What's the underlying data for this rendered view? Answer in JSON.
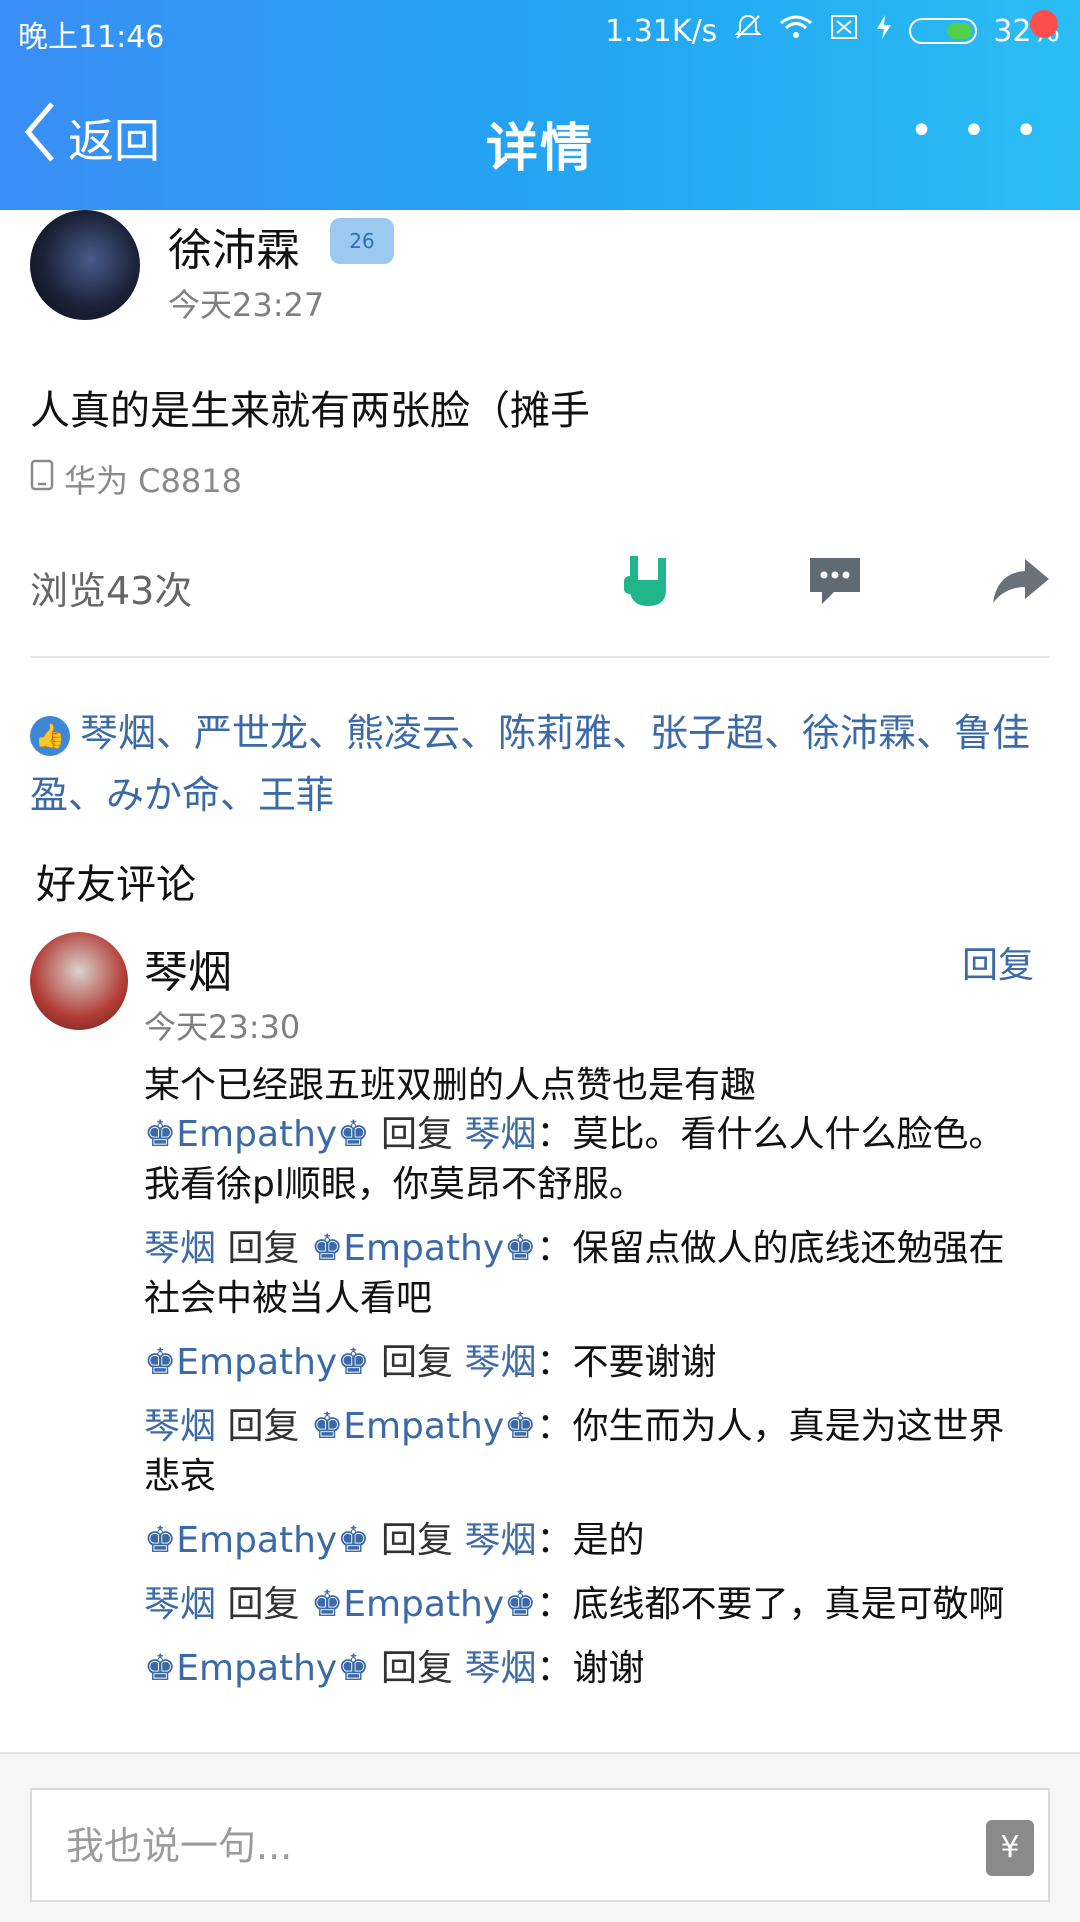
{
  "status_bar": {
    "time": "晚上11:46",
    "speed": "1.31K/s",
    "battery": "32%"
  },
  "nav": {
    "back_label": "返回",
    "title": "详情",
    "more_label": "• • •"
  },
  "post": {
    "author": "徐沛霖",
    "badge_text": "26",
    "time": "今天23:27",
    "content": "人真的是生来就有两张脸（摊手",
    "device": "华为 C8818",
    "views": "浏览43次"
  },
  "likes": {
    "names": [
      "琴烟",
      "严世龙",
      "熊凌云",
      "陈莉雅",
      "张子超",
      "徐沛霖",
      "鲁佳盈",
      "みか命",
      "王菲"
    ],
    "text": "琴烟、严世龙、熊凌云、陈莉雅、张子超、徐沛霖、鲁佳盈、みか命、王菲"
  },
  "comments_section_title": "好友评论",
  "comment": {
    "author": "琴烟",
    "reply_label": "回复",
    "time": "今天23:30",
    "text": "某个已经跟五班双删的人点赞也是有趣"
  },
  "replies": [
    {
      "from": "♚Empathy♚",
      "word": "回复",
      "to": "琴烟",
      "text": "：莫比。看什么人什么脸色。我看徐pl顺眼，你莫昂不舒服。"
    },
    {
      "from": "琴烟",
      "word": "回复",
      "to": "♚Empathy♚",
      "text": "：保留点做人的底线还勉强在社会中被当人看吧"
    },
    {
      "from": "♚Empathy♚",
      "word": "回复",
      "to": "琴烟",
      "text": "：不要谢谢"
    },
    {
      "from": "琴烟",
      "word": "回复",
      "to": "♚Empathy♚",
      "text": "：你生而为人，真是为这世界悲哀"
    },
    {
      "from": "♚Empathy♚",
      "word": "回复",
      "to": "琴烟",
      "text": "：是的"
    },
    {
      "from": "琴烟",
      "word": "回复",
      "to": "♚Empathy♚",
      "text": "：底线都不要了，真是可敬啊"
    },
    {
      "from": "♚Empathy♚",
      "word": "回复",
      "to": "琴烟",
      "text": "：谢谢"
    }
  ],
  "input": {
    "placeholder": "我也说一句..."
  },
  "colors": {
    "header": "#2aa6f3",
    "link": "#3b6aa6",
    "like_icon": "#3d88d6",
    "like_gesture": "#20b58a"
  }
}
